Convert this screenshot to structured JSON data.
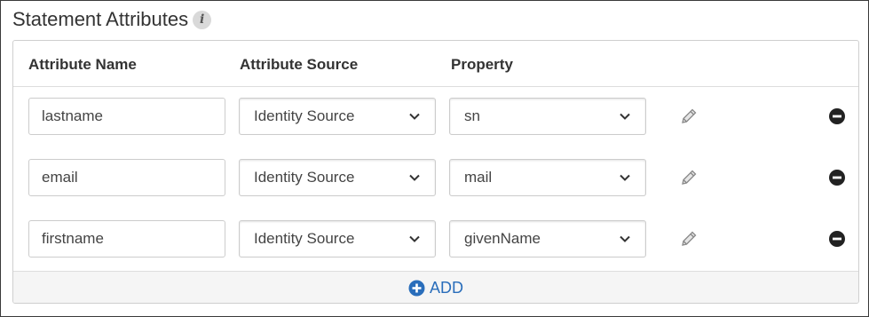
{
  "section": {
    "title": "Statement Attributes",
    "info_icon": "info-icon",
    "info_glyph": "i"
  },
  "table": {
    "headers": {
      "name": "Attribute Name",
      "source": "Attribute Source",
      "property": "Property"
    },
    "rows": [
      {
        "name": "lastname",
        "source": "Identity Source",
        "property": "sn"
      },
      {
        "name": "email",
        "source": "Identity Source",
        "property": "mail"
      },
      {
        "name": "firstname",
        "source": "Identity Source",
        "property": "givenName"
      }
    ],
    "row_icons": {
      "edit": "pencil-icon",
      "remove": "minus-circle-icon"
    }
  },
  "footer": {
    "add_label": "ADD",
    "add_icon": "plus-circle-icon"
  },
  "colors": {
    "accent": "#2a6ebb",
    "icon_dark": "#222222",
    "icon_gray": "#888888",
    "footer_bg": "#f5f5f5"
  }
}
